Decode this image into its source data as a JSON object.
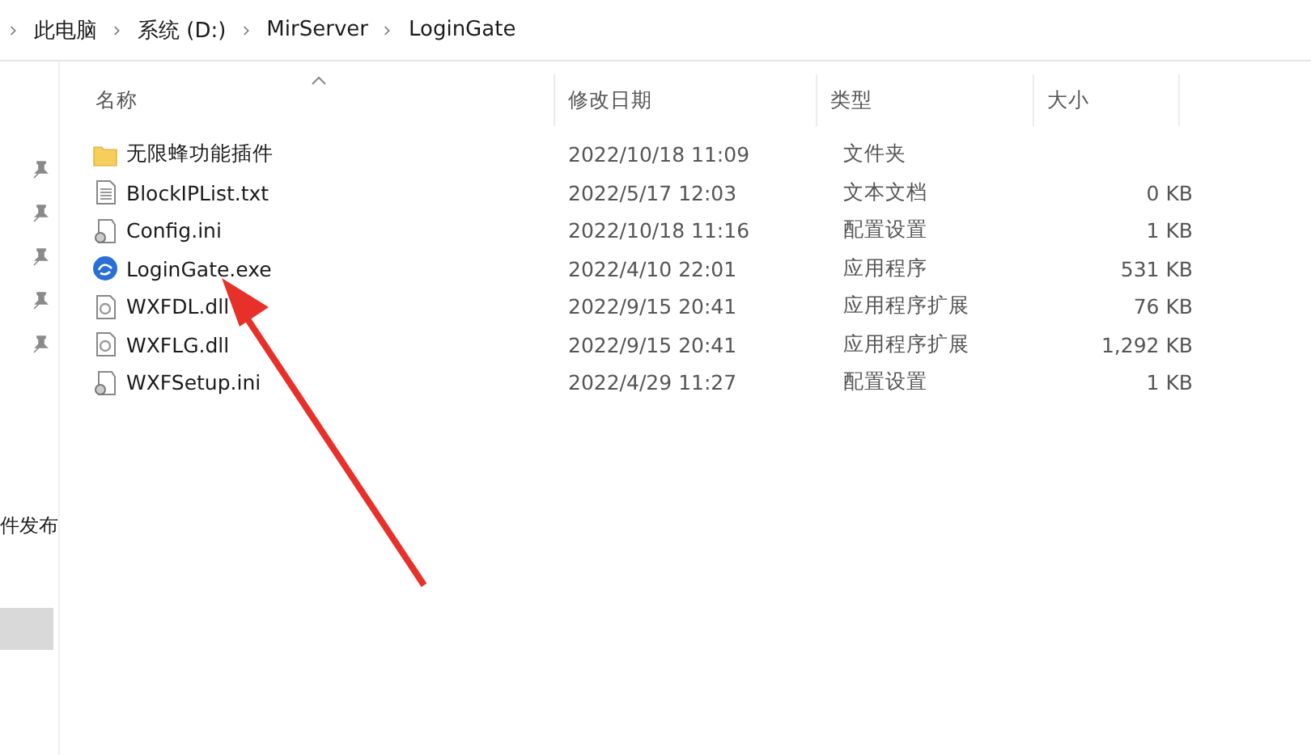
{
  "breadcrumb": [
    "此电脑",
    "系统 (D:)",
    "MirServer",
    "LoginGate"
  ],
  "sidebar": {
    "pinned_count_icons": [
      {
        "pinned": true
      },
      {
        "pinned": true
      },
      {
        "pinned": true
      },
      {
        "pinned": true
      },
      {
        "pinned": true
      }
    ],
    "items": [
      {
        "label": "件发布",
        "selected": false
      },
      {
        "selected": true
      }
    ]
  },
  "table": {
    "columns": [
      "名称",
      "修改日期",
      "类型",
      "大小"
    ],
    "rows": [
      {
        "kind": "folder",
        "name": "无限蜂功能插件",
        "modified": "2022/10/18 11:09",
        "type": "文件夹"
      },
      {
        "kind": "text",
        "name": "BlockIPList.txt",
        "modified": "2022/5/17 12:03",
        "type": "文本文档",
        "size": "0 KB"
      },
      {
        "kind": "config",
        "name": "Config.ini",
        "modified": "2022/10/18 11:16",
        "type": "配置设置",
        "size": "1 KB"
      },
      {
        "kind": "app",
        "name": "LoginGate.exe",
        "modified": "2022/4/10 22:01",
        "type": "应用程序",
        "size": "531 KB"
      },
      {
        "kind": "dll",
        "name": "WXFDL.dll",
        "modified": "2022/9/15 20:41",
        "type": "应用程序扩展",
        "size": "76 KB"
      },
      {
        "kind": "dll",
        "name": "WXFLG.dll",
        "modified": "2022/9/15 20:41",
        "type": "应用程序扩展",
        "size": "1,292 KB"
      },
      {
        "kind": "config",
        "name": "WXFSetup.ini",
        "modified": "2022/4/29 11:27",
        "type": "配置设置",
        "size": "1 KB"
      }
    ]
  }
}
